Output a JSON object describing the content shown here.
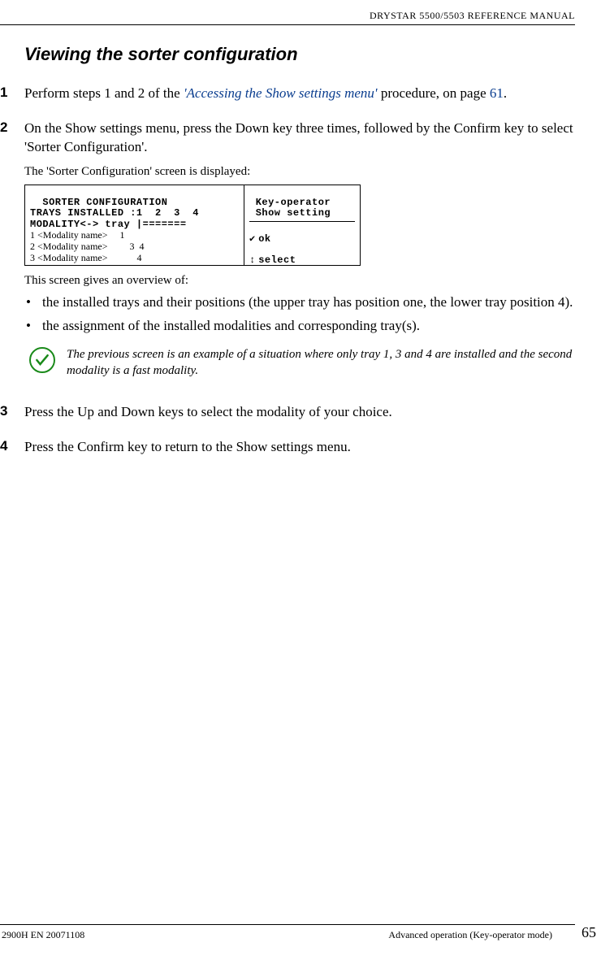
{
  "header": {
    "doc_title": "DRYSTAR 5500/5503 REFERENCE MANUAL"
  },
  "section_title": "Viewing the sorter configuration",
  "steps": {
    "s1": {
      "num": "1",
      "text_a": "Perform steps 1 and 2 of the ",
      "link": "'Accessing the Show settings menu'",
      "text_b": " procedure, on page ",
      "pagelink": "61",
      "text_c": "."
    },
    "s2": {
      "num": "2",
      "text": "On the Show settings menu, press the Down key three times, followed by the Confirm key to select 'Sorter Configuration'.",
      "sub": "The 'Sorter Configuration' screen is displayed:",
      "overview_intro": "This screen gives an overview of:",
      "bullet1": "the installed trays and their positions (the upper tray has position one, the lower tray position 4).",
      "bullet2": "the assignment of the installed modalities and corresponding tray(s).",
      "note": "The previous screen is an example of a situation where only tray 1, 3 and 4 are installed and the second modality is a fast modality."
    },
    "s3": {
      "num": "3",
      "text": "Press the Up and Down keys to select the modality of your choice."
    },
    "s4": {
      "num": "4",
      "text": "Press the Confirm key to return to the Show settings menu."
    }
  },
  "screenshot": {
    "line1": "  SORTER CONFIGURATION",
    "line2": "TRAYS INSTALLED :1  2  3  4",
    "line3": "MODALITY<-> tray |=======",
    "line4": "1 <Modality name>     1",
    "line5": "2 <Modality name>         3  4",
    "line6": "3 <Modality name>            4",
    "right1": " Key-operator",
    "right2": " Show setting",
    "right_ok": "ok",
    "right_sel": "select"
  },
  "footer": {
    "left": "2900H EN 20071108",
    "right": "Advanced operation (Key-operator mode)",
    "page": "65"
  }
}
